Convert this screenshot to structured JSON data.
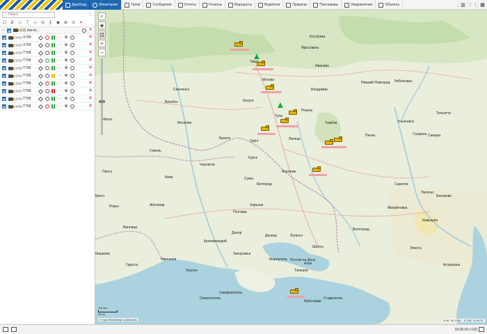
{
  "topbar": {
    "nav": [
      {
        "label": "Дашборд",
        "icon": "dashboard-icon",
        "style": "primary"
      },
      {
        "label": "Мониторинг",
        "icon": "monitoring-icon",
        "style": "active"
      },
      {
        "label": "Треки",
        "icon": "tracks-icon"
      },
      {
        "label": "Сообщения",
        "icon": "messages-icon"
      },
      {
        "label": "Отчеты",
        "icon": "reports-icon"
      },
      {
        "label": "Геозоны",
        "icon": "geofences-icon"
      },
      {
        "label": "Маршруты",
        "icon": "routes-icon"
      },
      {
        "label": "Водители",
        "icon": "drivers-icon"
      },
      {
        "label": "Прицепы",
        "icon": "trailers-icon"
      },
      {
        "label": "Пассажиры",
        "icon": "passengers-icon"
      },
      {
        "label": "Уведомления",
        "icon": "notifications-icon"
      },
      {
        "label": "Объекты",
        "icon": "objects-icon"
      }
    ]
  },
  "sidebar": {
    "search_placeholder": "Поиск",
    "group_label": "(10) Автоп...",
    "units": [
      {
        "name": "X799",
        "state": "stop"
      },
      {
        "name": "X799",
        "state": "stop"
      },
      {
        "name": "T799",
        "state": "stop"
      },
      {
        "name": "T799",
        "state": "move"
      },
      {
        "name": "T799",
        "state": "stop"
      },
      {
        "name": "T799",
        "state": "stop"
      },
      {
        "name": "T799",
        "state": "stop"
      },
      {
        "name": "T799",
        "state": "idle"
      },
      {
        "name": "T799",
        "state": "stop"
      },
      {
        "name": "T799",
        "state": "stop"
      }
    ]
  },
  "map": {
    "cities": [
      {
        "name": "Тверь"
      },
      {
        "name": "Москва"
      },
      {
        "name": "Тула"
      },
      {
        "name": "Калуга"
      },
      {
        "name": "Рязань"
      },
      {
        "name": "Орёл"
      },
      {
        "name": "Курск"
      },
      {
        "name": "Воронеж"
      },
      {
        "name": "Липецк"
      },
      {
        "name": "Тамбов"
      },
      {
        "name": "Белгород"
      },
      {
        "name": "Харьков"
      },
      {
        "name": "Брянск"
      },
      {
        "name": "Смоленск"
      },
      {
        "name": "Киев"
      },
      {
        "name": "Днепр"
      },
      {
        "name": "Донецк"
      },
      {
        "name": "Луганск"
      },
      {
        "name": "Ростов-на-Дону"
      },
      {
        "name": "Волгоград"
      },
      {
        "name": "Саратов"
      },
      {
        "name": "Пенза"
      },
      {
        "name": "Ульяновск"
      },
      {
        "name": "Самара"
      },
      {
        "name": "Чебоксары"
      },
      {
        "name": "Нижний Новгород"
      },
      {
        "name": "Ярославль"
      },
      {
        "name": "Кострома"
      },
      {
        "name": "Иваново"
      },
      {
        "name": "Владимир"
      },
      {
        "name": "Краснодар"
      },
      {
        "name": "Ставрополь"
      },
      {
        "name": "Элиста"
      },
      {
        "name": "Астрахань"
      },
      {
        "name": "Одесса"
      },
      {
        "name": "Николаев"
      },
      {
        "name": "Херсон"
      },
      {
        "name": "Запорожье"
      },
      {
        "name": "Мариуполь"
      },
      {
        "name": "Симферополь"
      },
      {
        "name": "Севастополь"
      },
      {
        "name": "Минск"
      },
      {
        "name": "Гомель"
      },
      {
        "name": "Витебск"
      },
      {
        "name": "Могилёв"
      },
      {
        "name": "Житомир"
      },
      {
        "name": "Винница"
      },
      {
        "name": "Кропивницкий"
      },
      {
        "name": "Полтава"
      },
      {
        "name": "Сумы"
      },
      {
        "name": "Чернигов"
      },
      {
        "name": "Пинск"
      },
      {
        "name": "Брест"
      },
      {
        "name": "Ровно"
      },
      {
        "name": "Кишинёв"
      },
      {
        "name": "Тольятти"
      },
      {
        "name": "Сызрань"
      },
      {
        "name": "Энгельс"
      },
      {
        "name": "Балаково"
      },
      {
        "name": "Камышин"
      },
      {
        "name": "Михайловка"
      },
      {
        "name": "Таганрог"
      },
      {
        "name": "Азов"
      },
      {
        "name": "Шахты"
      }
    ],
    "zoom_in": "+",
    "zoom_out": "−",
    "scale_top": "100 km",
    "scale_bottom": "50 mi",
    "attribution": "© OpenStreetMap contributors",
    "coords": "N 59° 56.1304' : E 028° 10.8175'"
  },
  "statusbar": {
    "clock": "18:38:18 (+03)"
  },
  "colors": {
    "brand_blue": "#1f67b1",
    "vehicle_yellow": "#e8b400",
    "danger_red": "#d9262c",
    "ok_green": "#2aa23c"
  }
}
